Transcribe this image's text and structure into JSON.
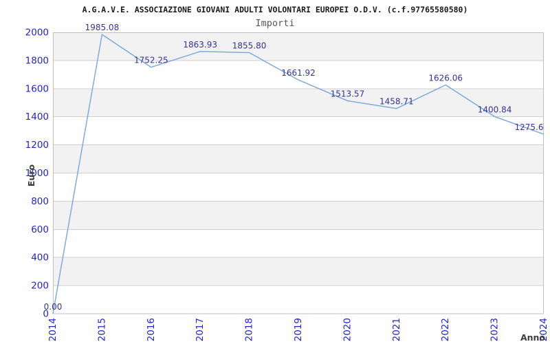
{
  "header": {
    "title": "A.G.A.V.E. ASSOCIAZIONE GIOVANI ADULTI VOLONTARI EUROPEI O.D.V. (c.f.97765580580)",
    "subtitle": "Importi"
  },
  "chart_data": {
    "type": "line",
    "title": "Importi",
    "categories": [
      "2014",
      "2015",
      "2016",
      "2017",
      "2018",
      "2019",
      "2020",
      "2021",
      "2022",
      "2023",
      "2024"
    ],
    "values": [
      0,
      1985.08,
      1752.25,
      1863.93,
      1855.8,
      1661.92,
      1513.57,
      1458.71,
      1626.06,
      1400.84,
      1275.6
    ],
    "point_labels": [
      "0.00",
      "1985.08",
      "1752.25",
      "1863.93",
      "1855.80",
      "1661.92",
      "1513.57",
      "1458.71",
      "1626.06",
      "1400.84",
      "1275.6"
    ],
    "xlabel": "Anno",
    "ylabel": "Euro",
    "ylim": [
      0,
      2000
    ],
    "ytick_step": 200,
    "y_ticks": [
      0,
      200,
      400,
      600,
      800,
      1000,
      1200,
      1400,
      1600,
      1800,
      2000
    ],
    "grid": true,
    "legend_position": "none",
    "colors": {
      "line": "#7daadd",
      "point_label": "#333399",
      "tick_label": "#2323cd",
      "axis_title": "#3d3d3d",
      "grid_line": "#cfcfcf",
      "band_fill": "#f2f2f2",
      "plot_border": "#c0c0c0",
      "title": "#1a1a1a",
      "subtitle": "#555555",
      "background": "#ffffff"
    }
  }
}
